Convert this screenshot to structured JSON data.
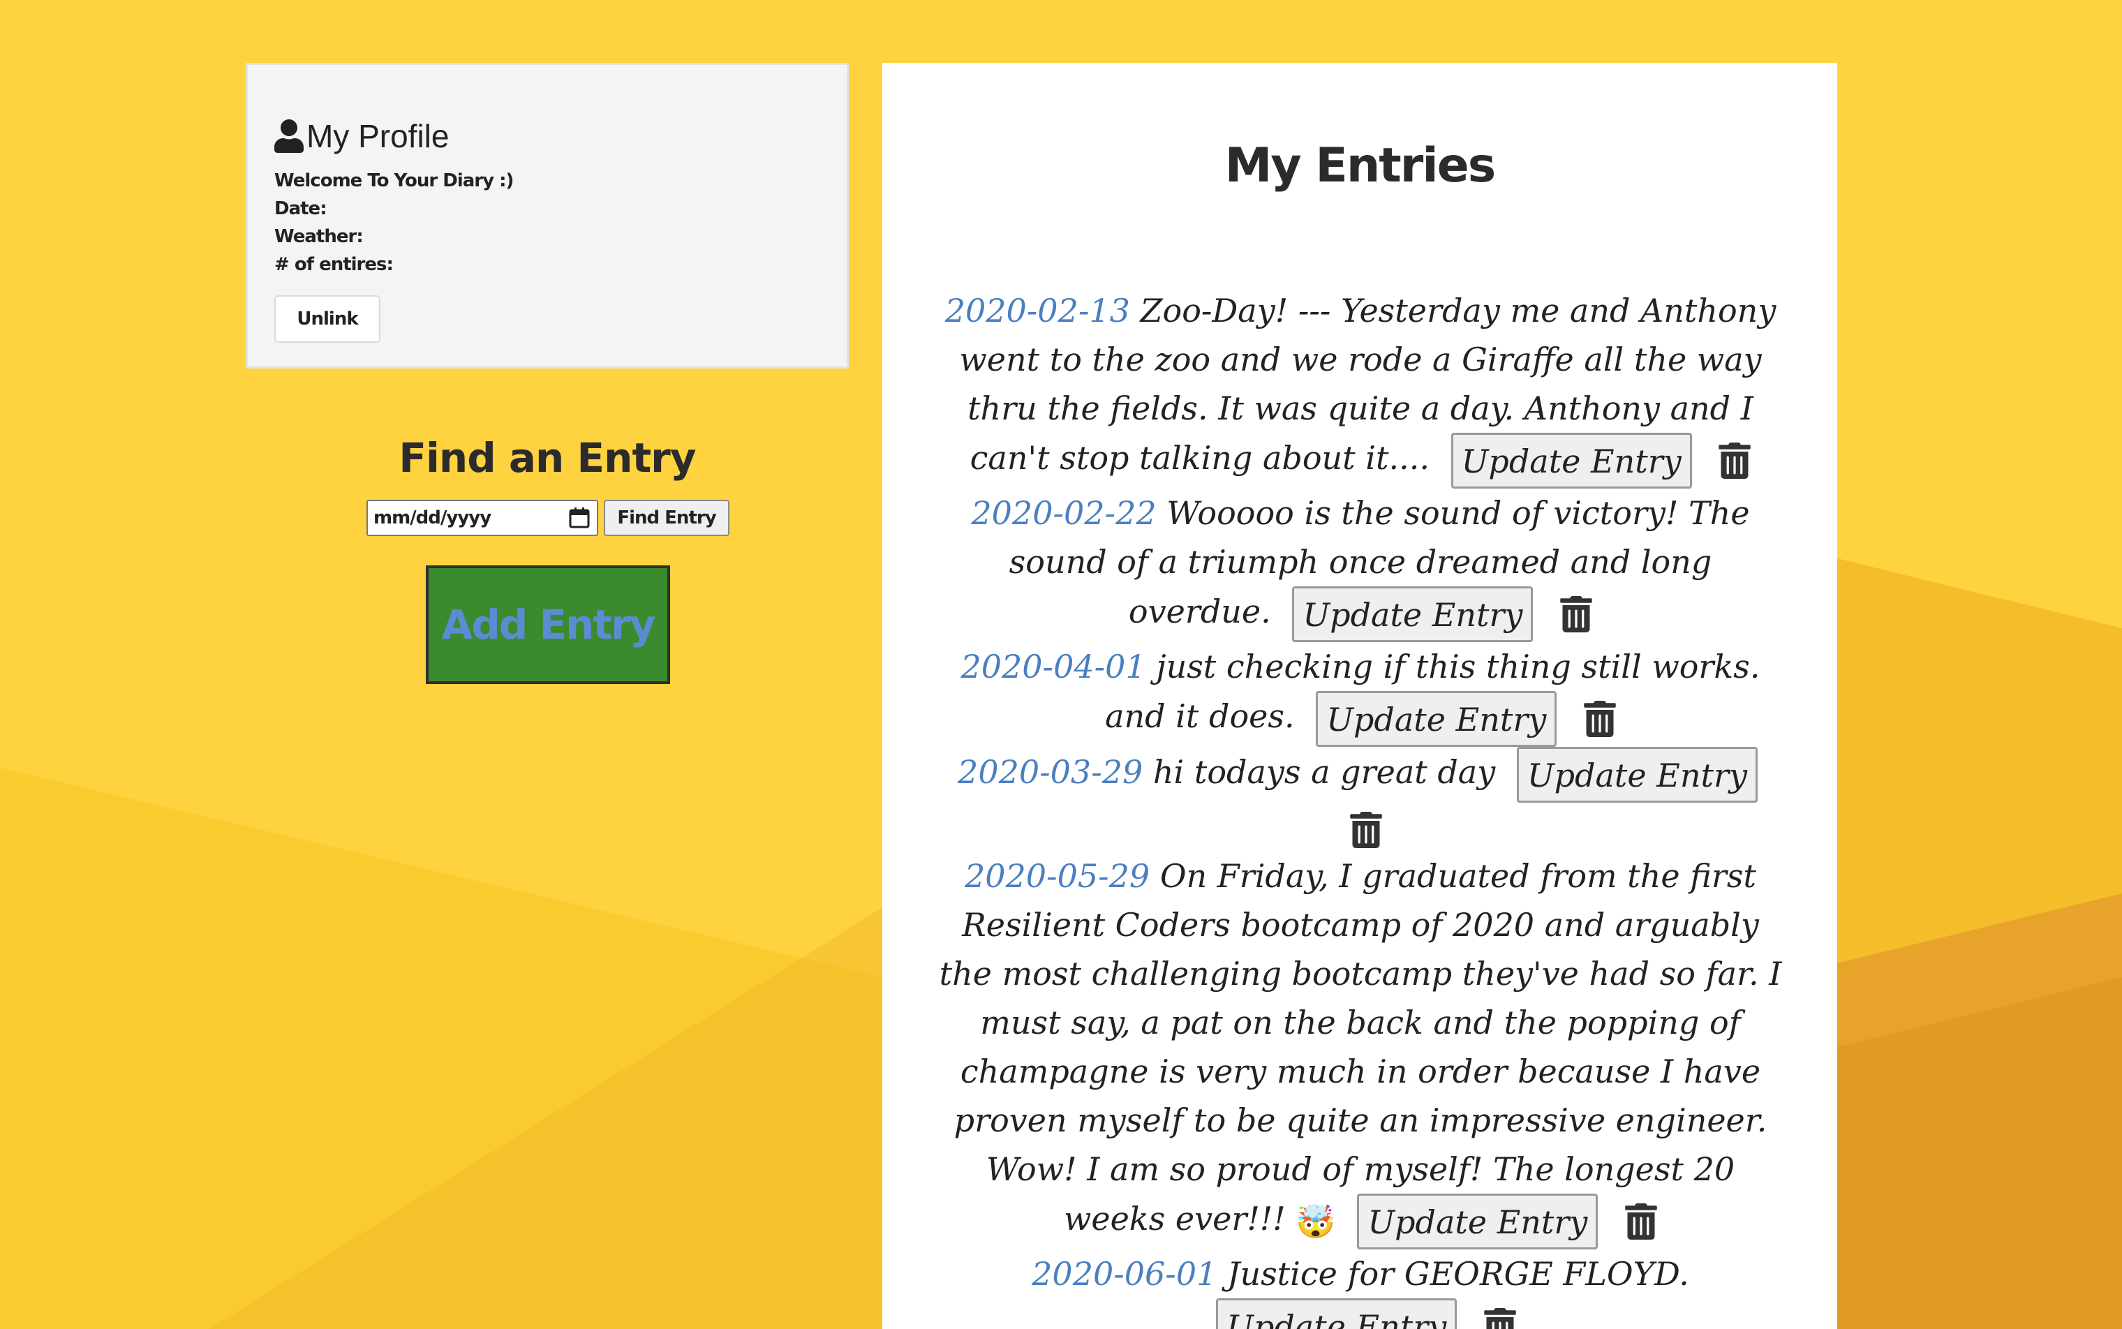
{
  "profile": {
    "title": "My Profile",
    "welcome": "Welcome To Your Diary :)",
    "date_label": "Date:",
    "weather_label": "Weather:",
    "entries_label": "# of entires:",
    "unlink_label": "Unlink"
  },
  "find": {
    "title": "Find an Entry",
    "date_placeholder": "mm/dd/yyyy",
    "button_label": "Find Entry"
  },
  "add_entry_label": "Add Entry",
  "entries": {
    "title": "My Entries",
    "update_label": "Update Entry",
    "items": [
      {
        "date": "2020-02-13",
        "text": "Zoo-Day! --- Yesterday me and Anthony went to the zoo and we rode a Giraffe all the way thru the fields. It was quite a day. Anthony and I can't stop talking about it...."
      },
      {
        "date": "2020-02-22",
        "text": "Wooooo is the sound of victory! The sound of a triumph once dreamed and long overdue."
      },
      {
        "date": "2020-04-01",
        "text": "just checking if this thing still works. and it does."
      },
      {
        "date": "2020-03-29",
        "text": "hi todays a great day"
      },
      {
        "date": "2020-05-29",
        "text": "On Friday, I graduated from the first Resilient Coders bootcamp of 2020 and arguably the most challenging bootcamp they've had so far. I must say, a pat on the back and the popping of champagne is very much in order because I have proven myself to be quite an impressive engineer. Wow! I am so proud of myself! The longest 20 weeks ever!!!",
        "emoji": "🤯"
      },
      {
        "date": "2020-06-01",
        "text": "Justice for GEORGE FLOYD."
      }
    ]
  },
  "icons": {
    "profile": "user-icon",
    "date_picker": "calendar-icon",
    "delete": "trash-icon"
  },
  "colors": {
    "background": "#ffd23f",
    "add_button_bg": "#3a8a2e",
    "add_button_text": "#5b8bd0",
    "entry_date": "#4a7fc0"
  }
}
